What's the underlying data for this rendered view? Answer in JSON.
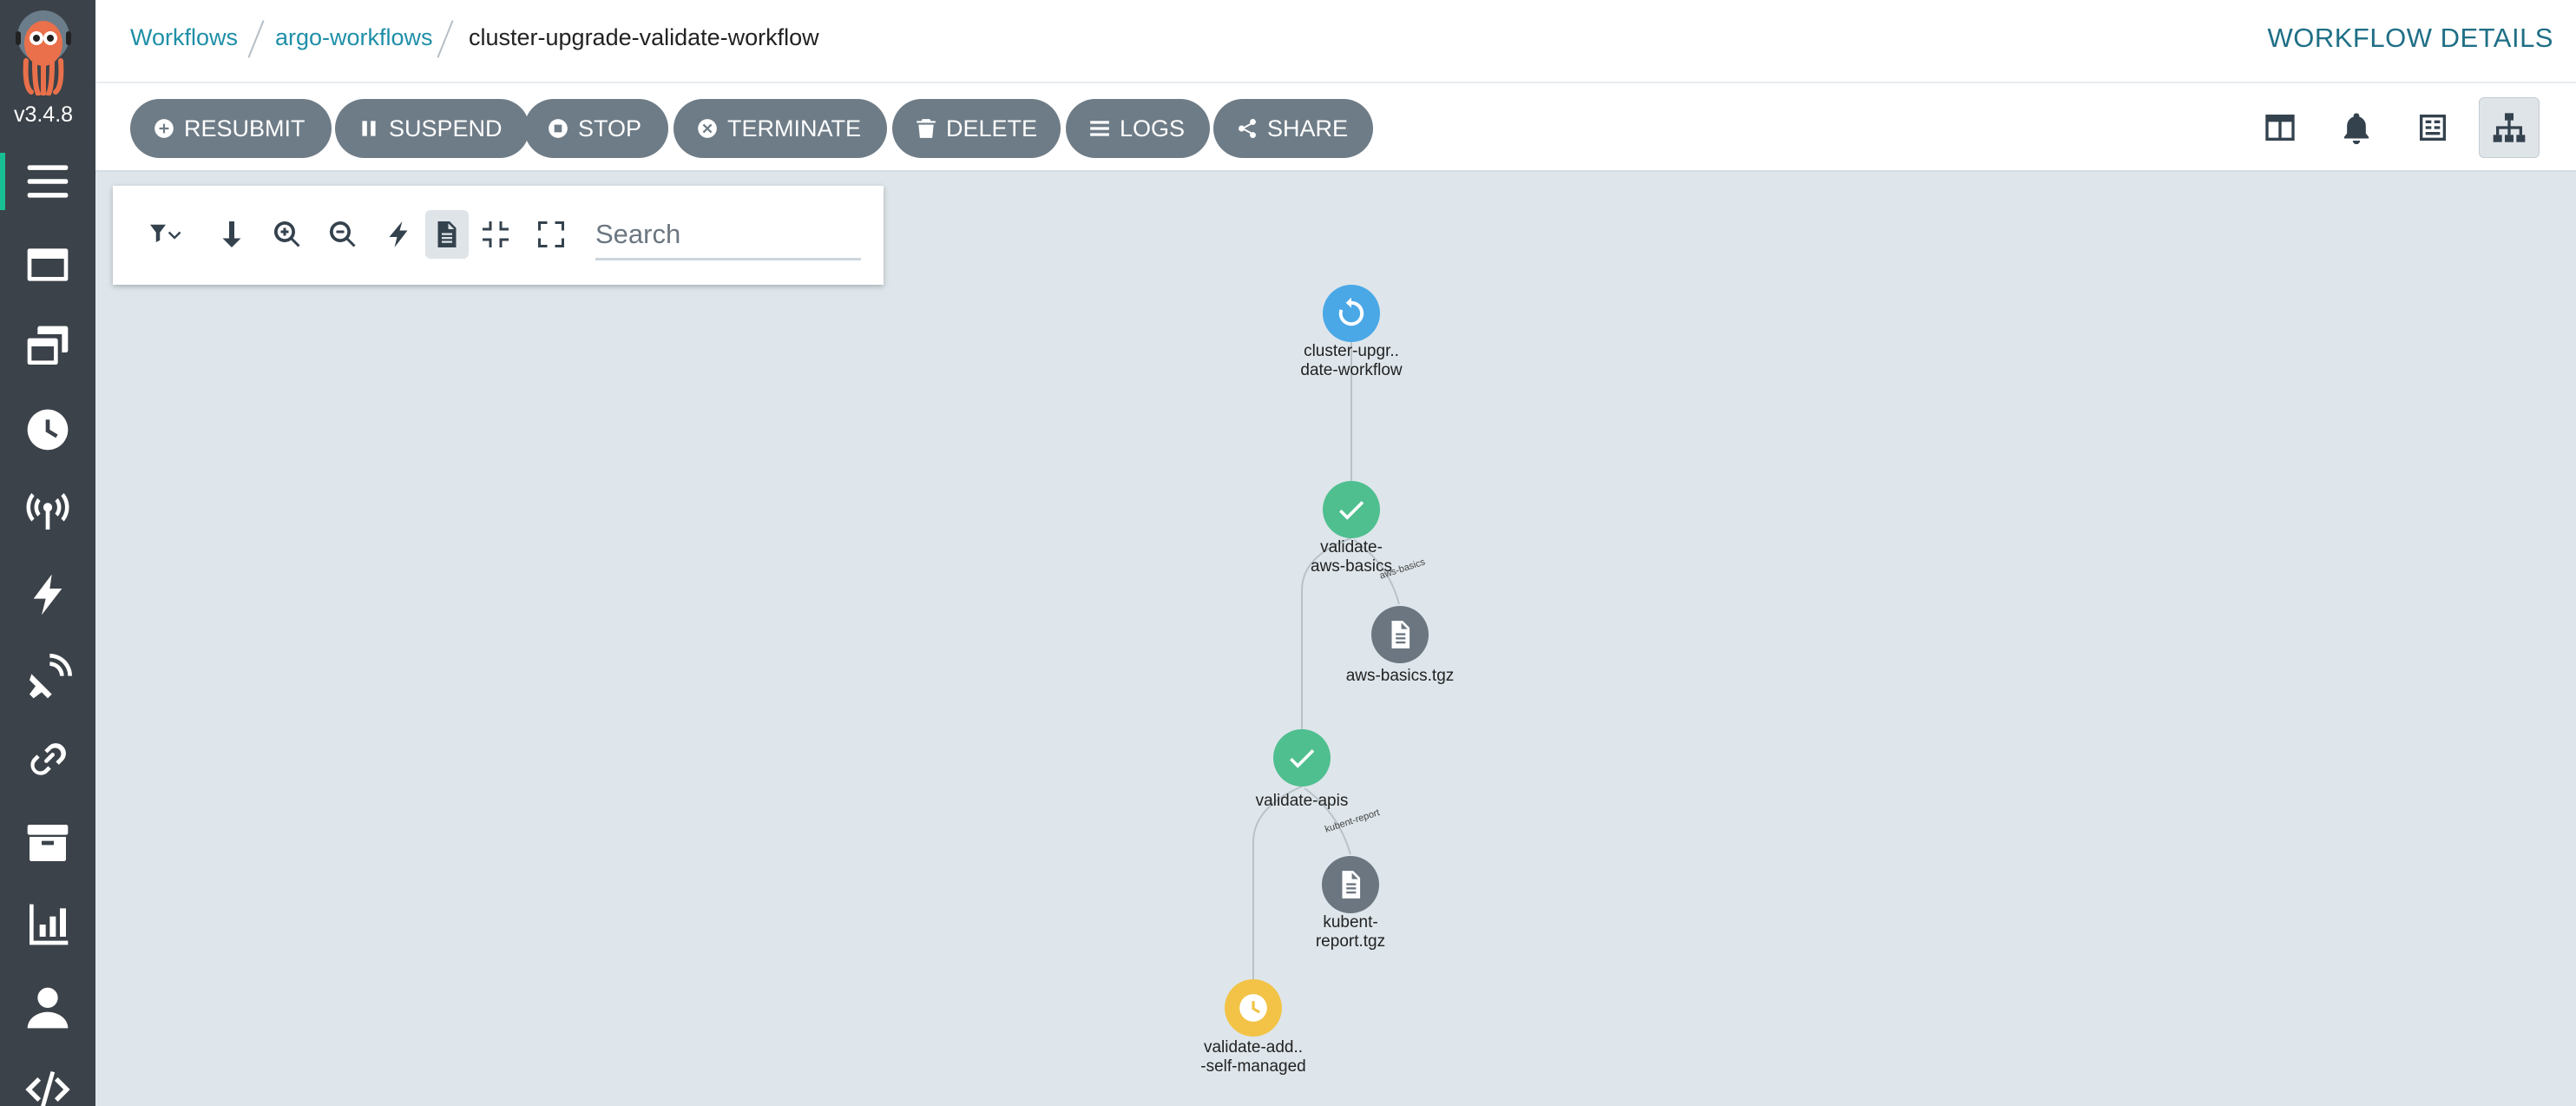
{
  "app": {
    "version": "v3.4.8"
  },
  "breadcrumb": {
    "items": [
      "Workflows",
      "argo-workflows"
    ],
    "current": "cluster-upgrade-validate-workflow"
  },
  "page_heading": "WORKFLOW DETAILS",
  "toolbar": {
    "buttons": [
      {
        "label": "RESUBMIT",
        "icon": "plus-circle-icon"
      },
      {
        "label": "SUSPEND",
        "icon": "pause-icon"
      },
      {
        "label": "STOP",
        "icon": "stop-circle-icon"
      },
      {
        "label": "TERMINATE",
        "icon": "times-circle-icon"
      },
      {
        "label": "DELETE",
        "icon": "trash-icon"
      },
      {
        "label": "LOGS",
        "icon": "bars-icon"
      },
      {
        "label": "SHARE",
        "icon": "share-icon"
      }
    ],
    "view_icons": [
      "columns-icon",
      "bell-icon",
      "summary-icon",
      "sitemap-icon"
    ]
  },
  "graph_panel": {
    "tools": [
      "filter-icon",
      "arrow-down-icon",
      "zoom-in-icon",
      "zoom-out-icon",
      "bolt-icon",
      "file-icon",
      "compress-icon",
      "expand-icon"
    ],
    "search_placeholder": "Search"
  },
  "sidebar": {
    "items": [
      "menu-icon",
      "workflow-templates-icon",
      "cluster-templates-icon",
      "cron-icon",
      "event-sources-icon",
      "sensors-icon",
      "event-flow-icon",
      "link-icon",
      "archive-icon",
      "reports-icon",
      "user-icon",
      "api-docs-icon"
    ]
  },
  "graph": {
    "nodes": [
      {
        "id": "root",
        "status": "running",
        "label_lines": [
          "cluster-upgr..",
          "date-workflow"
        ]
      },
      {
        "id": "aws",
        "status": "succeeded",
        "label_lines": [
          "validate-",
          "aws-basics"
        ]
      },
      {
        "id": "aws-artifact",
        "status": "artifact",
        "label_lines": [
          "aws-basics.tgz"
        ]
      },
      {
        "id": "apis",
        "status": "succeeded",
        "label_lines": [
          "validate-apis"
        ]
      },
      {
        "id": "kubent-artifact",
        "status": "artifact",
        "label_lines": [
          "kubent-",
          "report.tgz"
        ]
      },
      {
        "id": "addons",
        "status": "pending",
        "label_lines": [
          "validate-add..",
          "-self-managed"
        ]
      }
    ],
    "edge_labels": [
      "aws-basics",
      "kubent-report"
    ]
  },
  "colors": {
    "sidebar_bg": "#3b4249",
    "canvas_bg": "#dee6eb",
    "button_bg": "#6e7c87",
    "link": "#1f8fa8",
    "running": "#4aa8e7",
    "succeeded": "#4fbf8f",
    "pending": "#f2c346",
    "artifact": "#6b7680"
  }
}
